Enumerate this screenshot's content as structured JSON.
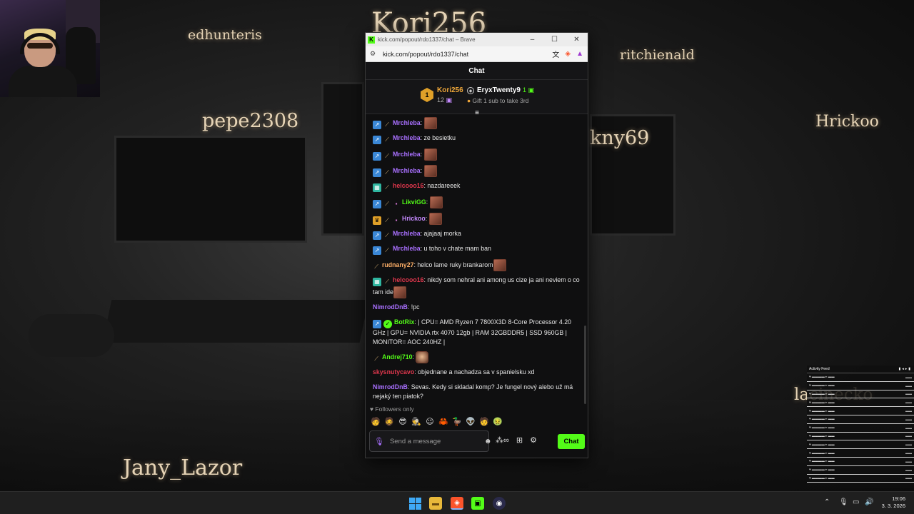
{
  "background": {
    "overlay_names": [
      "edhunteris",
      "Kori256",
      "ritchienald",
      "pepe2308",
      "kny69",
      "Hrickoo",
      "lacinecko",
      "Jany_Lazor"
    ]
  },
  "browser": {
    "title": "kick.com/popout/rdo1337/chat – Brave",
    "url": "kick.com/popout/rdo1337/chat",
    "window_buttons": [
      "–",
      "☐",
      "✕"
    ]
  },
  "chat": {
    "header_title": "Chat",
    "leaderboard": {
      "first": {
        "rank": "1",
        "name": "Kori256",
        "count": "12"
      },
      "second": {
        "name": "EryxTwenty9",
        "count": "1"
      },
      "gift_text": "Gift 1 sub to take 3rd"
    },
    "messages": [
      {
        "badges": [
          "arrow",
          "sword"
        ],
        "user": "Mrchleba",
        "color": "purple",
        "text": "",
        "emote": true
      },
      {
        "badges": [
          "arrow",
          "sword"
        ],
        "user": "Mrchleba",
        "color": "purple",
        "text": "ze besietku",
        "emote": false
      },
      {
        "badges": [
          "arrow",
          "sword"
        ],
        "user": "Mrchleba",
        "color": "purple",
        "text": "",
        "emote": true
      },
      {
        "badges": [
          "arrow",
          "sword"
        ],
        "user": "Mrchleba",
        "color": "purple",
        "text": "",
        "emote": true
      },
      {
        "badges": [
          "grid",
          "sword"
        ],
        "user": "helcooo16",
        "color": "red",
        "text": "nazdareeek",
        "emote": false
      },
      {
        "badges": [
          "arrow",
          "sword",
          "gift"
        ],
        "user": "LikviGG",
        "color": "green",
        "text": "",
        "emote": true
      },
      {
        "badges": [
          "crown",
          "sword",
          "gift"
        ],
        "user": "Hrickoo",
        "color": "violet",
        "text": "",
        "emote": true
      },
      {
        "badges": [
          "arrow",
          "sword"
        ],
        "user": "Mrchleba",
        "color": "purple",
        "text": "ajajaaj morka",
        "emote": false
      },
      {
        "badges": [
          "arrow",
          "sword"
        ],
        "user": "Mrchleba",
        "color": "purple",
        "text": "u toho v chate mam ban",
        "emote": false
      },
      {
        "badges": [
          "sword"
        ],
        "user": "rudnany27",
        "color": "orange",
        "text": "helco lame ruky brankarom",
        "emote": true
      },
      {
        "badges": [
          "grid",
          "sword"
        ],
        "user": "helcooo16",
        "color": "red",
        "text": "nikdy som nehral ani among us cize ja ani neviem o co tam ide",
        "emote": true
      },
      {
        "badges": [],
        "user": "NimrodDnB",
        "color": "purple",
        "text": "!pc",
        "emote": false
      },
      {
        "badges": [
          "arrow",
          "verified"
        ],
        "user": "BotRix",
        "color": "green",
        "text": "| CPU= AMD Ryzen 7 7800X3D 8-Core Processor 4.20 GHz | GPU= NVIDIA rtx 4070 12gb | RAM 32GBDDR5 | SSD 960GB | MONITOR= AOC 240HZ |",
        "emote": false
      },
      {
        "badges": [
          "sword"
        ],
        "user": "Andrej710",
        "color": "green",
        "text": "",
        "emote": true
      },
      {
        "badges": [],
        "user": "skysnutycavo",
        "color": "red",
        "text": "objednane a nachadza sa v spanielsku xd",
        "emote": false
      },
      {
        "badges": [],
        "user": "NimrodDnB",
        "color": "purple",
        "text": "Sevas. Kedy si skladal komp? Je fungel nový alebo už má nejaký ten piatok?",
        "emote": false
      }
    ],
    "followers_only": "Followers only",
    "quick_emotes": [
      "🧑",
      "🧔",
      "😎",
      "🕵",
      "😉",
      "🦀",
      "🦆",
      "👽",
      "🧑",
      "🤢"
    ],
    "input_placeholder": "Send a message",
    "send_label": "Chat"
  },
  "activity_feed": {
    "title": "Activity Feed",
    "rows": 13
  },
  "taskbar": {
    "time": "19:06",
    "date": "3. 3. 2026"
  },
  "colors": {
    "kick_green": "#53fc18",
    "purple": "#a970ff",
    "red": "#e0374d",
    "violet": "#c58aff",
    "orange": "#ffb068"
  }
}
